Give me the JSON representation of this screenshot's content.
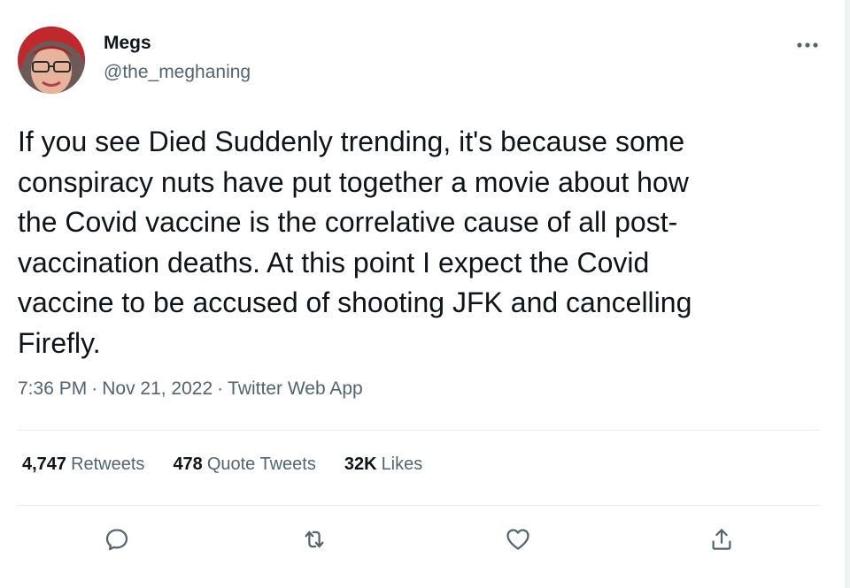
{
  "author": {
    "name": "Megs",
    "handle": "@the_meghaning"
  },
  "tweet": {
    "text": "If you see Died Suddenly trending, it's because some\nconspiracy nuts have put together a movie about how\nthe Covid vaccine is the correlative cause of all post-\nvaccination deaths. At this point I expect the Covid\nvaccine to be accused of shooting JFK and cancelling\nFirefly.",
    "time": "7:36 PM",
    "separator": "·",
    "date": "Nov 21, 2022",
    "source": "Twitter Web App"
  },
  "stats": {
    "retweets_count": "4,747",
    "retweets_label": "Retweets",
    "quotes_count": "478",
    "quotes_label": "Quote Tweets",
    "likes_count": "32K",
    "likes_label": "Likes"
  },
  "icons": {
    "more": "more-horizontal-icon",
    "reply": "reply-icon",
    "retweet": "retweet-icon",
    "like": "heart-icon",
    "share": "share-icon"
  },
  "colors": {
    "primary_text": "#0f1419",
    "secondary_text": "#536471",
    "divider": "#e7e9ea",
    "avatar_hair": "#c0282e"
  }
}
